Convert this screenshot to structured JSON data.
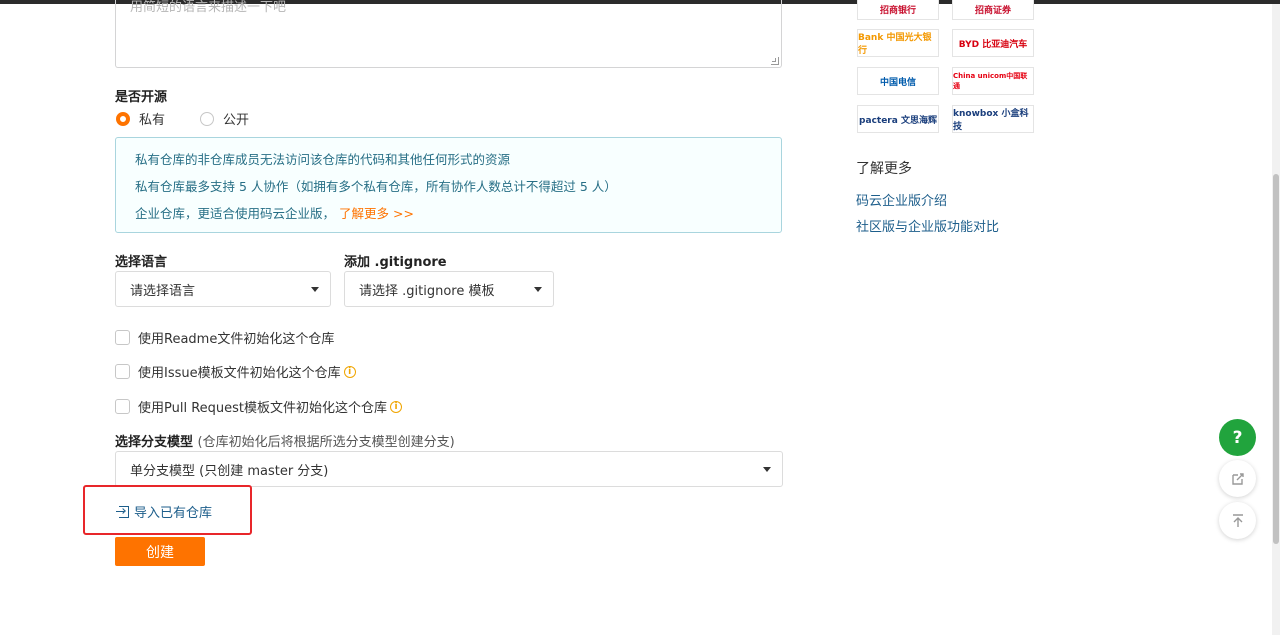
{
  "description": {
    "placeholder": "用简短的语言来描述一下吧"
  },
  "visibility": {
    "label": "是否开源",
    "options": [
      {
        "label": "私有",
        "selected": true
      },
      {
        "label": "公开",
        "selected": false
      }
    ]
  },
  "notice": {
    "line1": "私有仓库的非仓库成员无法访问该仓库的代码和其他任何形式的资源",
    "line2": "私有仓库最多支持 5 人协作（如拥有多个私有仓库，所有协作人数总计不得超过 5 人）",
    "line3": "企业仓库，更适合使用码云企业版，",
    "link": "了解更多 >>"
  },
  "language": {
    "label": "选择语言",
    "value": "请选择语言"
  },
  "gitignore": {
    "label": "添加 .gitignore",
    "value": "请选择 .gitignore 模板"
  },
  "options": {
    "readme": "使用Readme文件初始化这个仓库",
    "issue": "使用Issue模板文件初始化这个仓库",
    "pr": "使用Pull Request模板文件初始化这个仓库"
  },
  "branch": {
    "label": "选择分支模型",
    "hint": "(仓库初始化后将根据所选分支模型创建分支)",
    "value": "单分支模型 (只创建 master 分支)"
  },
  "import_label": "导入已有仓库",
  "create_label": "创建",
  "sidebar": {
    "logos": [
      {
        "name": "招商银行",
        "color": "#c8102e"
      },
      {
        "name": "招商证券",
        "color": "#c8102e"
      },
      {
        "name": "Bank 中国光大银行",
        "color": "#f39800"
      },
      {
        "name": "BYD 比亚迪汽车",
        "color": "#d7000f"
      },
      {
        "name": "中国电信",
        "color": "#005bac"
      },
      {
        "name": "China unicom中国联通",
        "color": "#e60012"
      },
      {
        "name": "pactera 文思海辉",
        "color": "#1a3e7c"
      },
      {
        "name": "knowbox 小盒科技",
        "color": "#1a3e7c"
      }
    ],
    "more_title": "了解更多",
    "links": [
      "码云企业版介绍",
      "社区版与企业版功能对比"
    ]
  },
  "float": {
    "help": "?"
  },
  "colors": {
    "accent": "#fe7300",
    "link": "#1d5e8b",
    "highlight": "#e8262a",
    "help": "#21a43d"
  }
}
